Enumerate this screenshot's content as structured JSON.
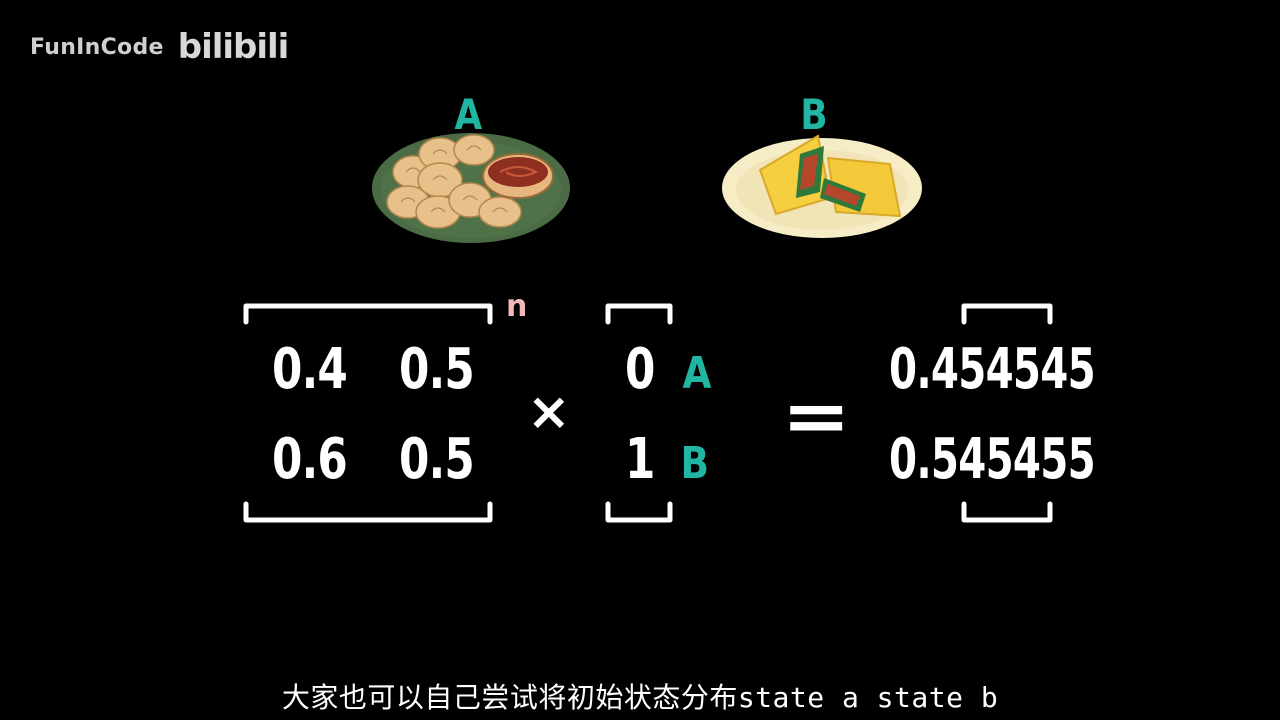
{
  "watermark": {
    "text": "FunInCode",
    "logo": "bilibili"
  },
  "foods": {
    "a": {
      "label": "A",
      "icon": "dumplings-plate-icon"
    },
    "b": {
      "label": "B",
      "icon": "egg-wrap-plate-icon"
    }
  },
  "equation": {
    "matrix": [
      [
        "0.4",
        "0.5"
      ],
      [
        "0.6",
        "0.5"
      ]
    ],
    "exponent": "n",
    "multiply": "×",
    "vector": [
      "0",
      "1"
    ],
    "vector_labels": [
      "A",
      "B"
    ],
    "equals": "=",
    "result": [
      "0.454545",
      "0.545455"
    ]
  },
  "subtitle": "大家也可以自己尝试将初始状态分布state a state b",
  "colors": {
    "accent": "#21b5a3",
    "exponent": "#f3b8b8",
    "background": "#000000"
  }
}
